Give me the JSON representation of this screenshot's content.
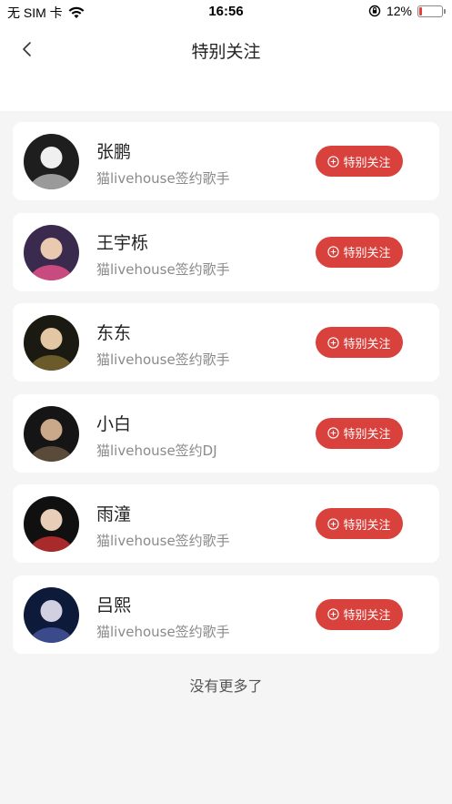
{
  "status_bar": {
    "carrier": "无 SIM 卡",
    "time": "16:56",
    "battery_percent": "12%",
    "battery_level": 0.12,
    "battery_color": "#e5413b"
  },
  "header": {
    "title": "特别关注"
  },
  "accent_color": "#d9413c",
  "list": [
    {
      "name": "张鹏",
      "desc": "猫livehouse签约歌手",
      "button": "特别关注",
      "avatar_colors": [
        "#1e1e1e",
        "#9a9a9a",
        "#f0f0f0"
      ]
    },
    {
      "name": "王宇栎",
      "desc": "猫livehouse签约歌手",
      "button": "特别关注",
      "avatar_colors": [
        "#3a2a4e",
        "#c94a7e",
        "#e9c9b0"
      ]
    },
    {
      "name": "东东",
      "desc": "猫livehouse签约歌手",
      "button": "特别关注",
      "avatar_colors": [
        "#1a1a12",
        "#6b5b2a",
        "#e3c6a4"
      ]
    },
    {
      "name": "小白",
      "desc": "猫livehouse签约DJ",
      "button": "特别关注",
      "avatar_colors": [
        "#151515",
        "#5a4a3a",
        "#c9a98a"
      ]
    },
    {
      "name": "雨潼",
      "desc": "猫livehouse签约歌手",
      "button": "特别关注",
      "avatar_colors": [
        "#101010",
        "#a82a2a",
        "#e8cdb8"
      ]
    },
    {
      "name": "吕熙",
      "desc": "猫livehouse签约歌手",
      "button": "特别关注",
      "avatar_colors": [
        "#0e1a3a",
        "#3a4a8a",
        "#d0d0e0"
      ]
    }
  ],
  "footer": {
    "text": "没有更多了"
  }
}
